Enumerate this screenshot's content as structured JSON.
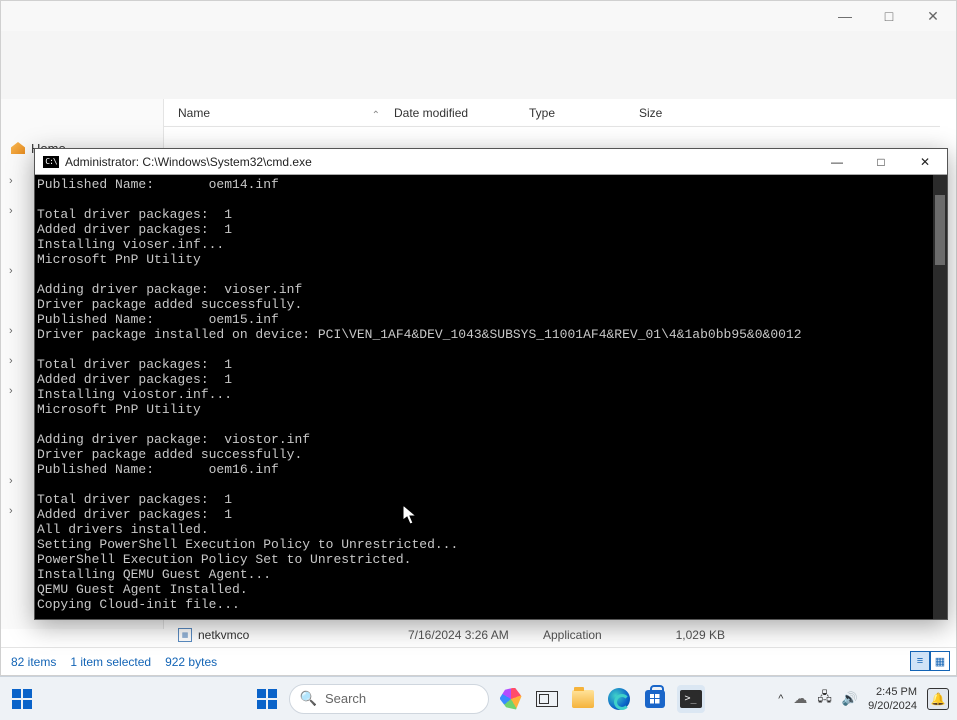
{
  "explorer": {
    "titlebar": {
      "minimize": "—",
      "maximize": "□",
      "close": "✕"
    },
    "sidebar": {
      "home": "Home"
    },
    "columns": {
      "name": "Name",
      "date": "Date modified",
      "type": "Type",
      "size": "Size"
    },
    "visible_row": {
      "name": "netkvmco",
      "date": "7/16/2024 3:26 AM",
      "type": "Application",
      "size": "1,029 KB"
    },
    "status": {
      "items": "82 items",
      "selection": "1 item selected",
      "selsize": "922 bytes"
    }
  },
  "cmd": {
    "title": "Administrator: C:\\Windows\\System32\\cmd.exe",
    "icon_text": "C:\\",
    "minimize": "—",
    "maximize": "□",
    "close": "✕",
    "output": "Published Name:       oem14.inf\n\nTotal driver packages:  1\nAdded driver packages:  1\nInstalling vioser.inf...\nMicrosoft PnP Utility\n\nAdding driver package:  vioser.inf\nDriver package added successfully.\nPublished Name:       oem15.inf\nDriver package installed on device: PCI\\VEN_1AF4&DEV_1043&SUBSYS_11001AF4&REV_01\\4&1ab0bb95&0&0012\n\nTotal driver packages:  1\nAdded driver packages:  1\nInstalling viostor.inf...\nMicrosoft PnP Utility\n\nAdding driver package:  viostor.inf\nDriver package added successfully.\nPublished Name:       oem16.inf\n\nTotal driver packages:  1\nAdded driver packages:  1\nAll drivers installed.\nSetting PowerShell Execution Policy to Unrestricted...\nPowerShell Execution Policy Set to Unrestricted.\nInstalling QEMU Guest Agent...\nQEMU Guest Agent Installed.\nCopying Cloud-init file..."
  },
  "taskbar": {
    "search_placeholder": "Search",
    "time": "2:45 PM",
    "date": "9/20/2024",
    "tray_chevron": "^"
  }
}
